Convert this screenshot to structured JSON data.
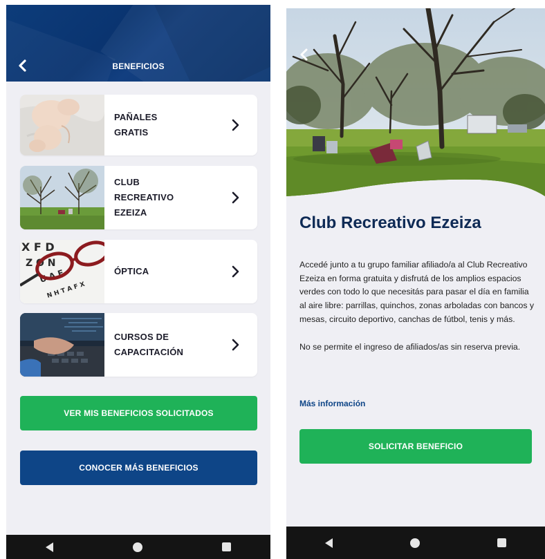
{
  "list_screen": {
    "header": {
      "title": "BENEFICIOS"
    },
    "cards": [
      {
        "label": "PAÑALES\nGRATIS"
      },
      {
        "label": "CLUB\nRECREATIVO\nEZEIZA"
      },
      {
        "label": "ÓPTICA"
      },
      {
        "label": "CURSOS DE\nCAPACITACIÓN"
      }
    ],
    "buttons": {
      "requested": "VER MIS BENEFICIOS SOLICITADOS",
      "more": "CONOCER MÁS BENEFICIOS"
    }
  },
  "detail_screen": {
    "title": "Club Recreativo Ezeiza",
    "paragraphs": [
      "Accedé junto a tu grupo familiar afiliado/a al Club Recreativo Ezeiza en forma gratuita y disfrutá de los amplios espacios verdes con todo lo que necesitás para pasar el día en familia al aire libre: parrillas, quinchos, zonas arboladas con bancos y mesas, circuito deportivo, canchas de fútbol, tenis y más.",
      "No se permite el ingreso de afiliados/as sin reserva previa."
    ],
    "more_link": "Más información",
    "request_button": "SOLICITAR BENEFICIO"
  },
  "icons": {
    "back": "chevron-left-icon",
    "card_arrow": "chevron-right-icon",
    "nav": [
      "nav-back-icon",
      "nav-home-icon",
      "nav-recent-icon"
    ]
  },
  "colors": {
    "brand_blue": "#0e4587",
    "header_blue": "#0d3c7a",
    "accent_green": "#1fb258",
    "title_navy": "#0e2a55",
    "background": "#efeff4"
  }
}
